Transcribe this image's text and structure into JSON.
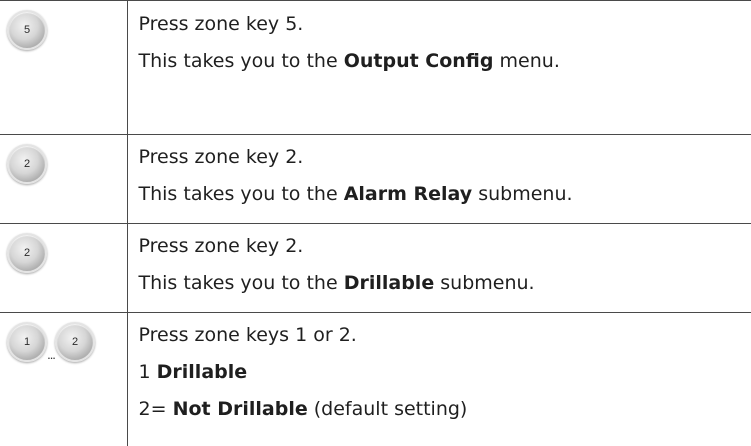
{
  "steps": [
    {
      "keys": [
        "5"
      ],
      "line1": "Press zone key 5.",
      "line2_prefix": "This takes you to the ",
      "line2_bold": "Output Config",
      "line2_suffix": " menu."
    },
    {
      "keys": [
        "2"
      ],
      "line1": "Press zone key 2.",
      "line2_prefix": "This takes you to the ",
      "line2_bold": "Alarm Relay",
      "line2_suffix": " submenu."
    },
    {
      "keys": [
        "2"
      ],
      "line1": "Press zone key 2.",
      "line2_prefix": "This takes you to the ",
      "line2_bold": "Drillable",
      "line2_suffix": " submenu."
    },
    {
      "keys": [
        "1",
        "2"
      ],
      "key_separator": "...",
      "line1": "Press zone keys 1 or 2.",
      "option1_prefix": "1 ",
      "option1_bold": "Drillable",
      "option2_prefix": "2= ",
      "option2_bold": "Not Drillable",
      "option2_suffix": " (default setting)"
    }
  ]
}
